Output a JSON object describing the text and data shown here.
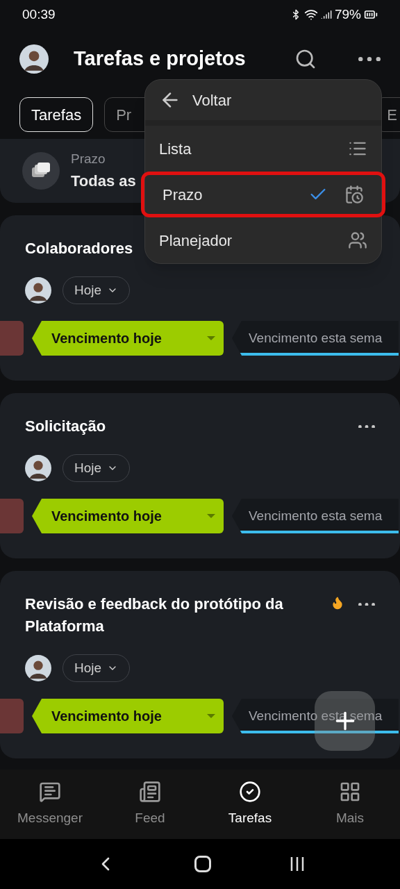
{
  "status_bar": {
    "time": "00:39",
    "battery": "79%"
  },
  "header": {
    "title": "Tarefas e projetos"
  },
  "tabs": [
    {
      "label": "Tarefas",
      "selected": true
    },
    {
      "label": "Pr",
      "selected": false
    },
    {
      "label": "E",
      "selected": false
    }
  ],
  "filter": {
    "label": "Prazo",
    "value": "Todas as"
  },
  "menu": {
    "back": "Voltar",
    "items": [
      {
        "label": "Lista",
        "kind": "list",
        "selected": false,
        "highlighted": false
      },
      {
        "label": "Prazo",
        "kind": "deadline",
        "selected": true,
        "highlighted": true
      },
      {
        "label": "Planejador",
        "kind": "planner",
        "selected": false,
        "highlighted": false
      }
    ]
  },
  "tasks": [
    {
      "title": "Colaboradores",
      "hot": false,
      "menu_button": false,
      "deadline": "Hoje",
      "stages": [
        {
          "color": "#6b3636",
          "selected": false
        },
        {
          "label": "Vencimento hoje",
          "color": "#9ccc00",
          "selected": true
        },
        {
          "label": "Vencimento esta sema",
          "color": "#3cbcec",
          "selected": false
        }
      ]
    },
    {
      "title": "Solicitação",
      "hot": false,
      "menu_button": true,
      "deadline": "Hoje",
      "stages": [
        {
          "color": "#6b3636",
          "selected": false
        },
        {
          "label": "Vencimento hoje",
          "color": "#9ccc00",
          "selected": true
        },
        {
          "label": "Vencimento esta sema",
          "color": "#3cbcec",
          "selected": false
        }
      ]
    },
    {
      "title": "Revisão e feedback do protótipo da Plataforma",
      "hot": true,
      "menu_button": true,
      "deadline": "Hoje",
      "stages": [
        {
          "color": "#6b3636",
          "selected": false
        },
        {
          "label": "Vencimento hoje",
          "color": "#9ccc00",
          "selected": true
        },
        {
          "label": "Vencimento esta sema",
          "color": "#3cbcec",
          "selected": false
        }
      ]
    }
  ],
  "bottom_nav": [
    {
      "label": "Messenger",
      "kind": "chat",
      "selected": false
    },
    {
      "label": "Feed",
      "kind": "feed",
      "selected": false
    },
    {
      "label": "Tarefas",
      "kind": "tasks",
      "selected": true
    },
    {
      "label": "Mais",
      "kind": "grid",
      "selected": false
    }
  ]
}
